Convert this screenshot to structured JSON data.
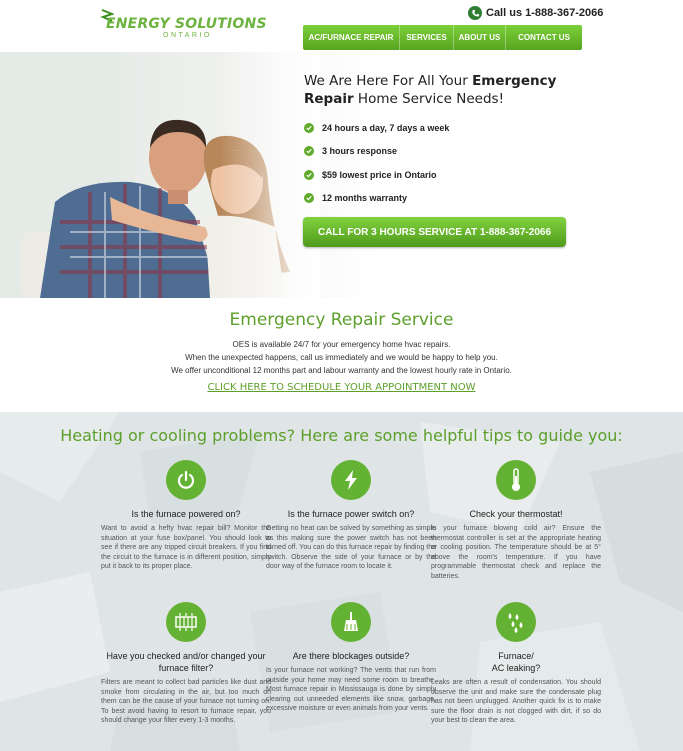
{
  "header": {
    "logo_title": "ENERGY SOLUTIONS",
    "logo_sub": "ONTARIO",
    "call_text": "Call us 1-888-367-2066",
    "nav": [
      "AC/FURNACE REPAIR",
      "SERVICES",
      "ABOUT US",
      "CONTACT US"
    ]
  },
  "hero": {
    "heading_pre": "We Are Here For All Your ",
    "heading_bold": "Emergency Repair",
    "heading_post": " Home Service Needs!",
    "features": [
      "24 hours a day, 7 days a week",
      "3 hours response",
      "$59 lowest price in Ontario",
      "12 months warranty"
    ],
    "cta": "CALL FOR 3 HOURS SERVICE AT 1-888-367-2066"
  },
  "emergency": {
    "title": "Emergency Repair Service",
    "lines": [
      "OES is available 24/7 for your emergency home hvac repairs.",
      "When the unexpected happens, call us immediately and we would be happy to help you.",
      "We offer unconditional 12 months part and labour warranty and the lowest hourly rate in Ontario."
    ],
    "link": "CLICK HERE TO SCHEDULE YOUR APPOINTMENT NOW"
  },
  "tips": {
    "title": "Heating or cooling problems? Here are some helpful tips to guide you:",
    "items": [
      {
        "icon": "power-icon",
        "title": "Is the furnace powered on?",
        "body": "Want to avoid a hefty hvac repair bill? Monitor the situation at your fuse box/panel. You should look to see if there are any tripped circuit breakers. If you find the circuit to the furnace is in different position, simply put it back to its proper place."
      },
      {
        "icon": "lightning-icon",
        "title": "Is the furnace power switch on?",
        "body": "Getting no heat can be solved by something as simple as this making sure the power switch has not been turned off. You can do this furnace repair by finding the switch. Observe the side of your furnace or by the door way of the furnace room to locate it."
      },
      {
        "icon": "thermometer-icon",
        "title": "Check your thermostat!",
        "body": "Is your furnace blowing cold air? Ensure the thermostat controller is set at the appropriate heating or cooling position. The temperature should be at 5° above the room's temperature. If you have programmable thermostat check and replace the batteries."
      },
      {
        "icon": "filter-icon",
        "title": "Have you checked and/or changed your furnace filter?",
        "body": "Filters are meant to collect bad particles like dust and smoke from circulating in the air, but too much on them can be the cause of your furnace not turning on. To best avoid having to resort to furnace repair, you should change your filter every 1-3 months."
      },
      {
        "icon": "broom-icon",
        "title": "Are there blockages outside?",
        "body": "Is your furnace not working? The vents that run from outside your home may need some room to breathe. Most furnace repair in Mississauga is done by simply clearing out unneeded elements like snow, garbage, excessive moisture or even animals from your vents."
      },
      {
        "icon": "water-drops-icon",
        "title": "Furnace/\nAC leaking?",
        "body": "Leaks are often a result of condensation. You should observe the unit and make sure the condensate plug has not been unplugged. Another quick fix is to make sure the floor drain is not clogged with dirt, if so do your best to clean the area."
      }
    ]
  }
}
